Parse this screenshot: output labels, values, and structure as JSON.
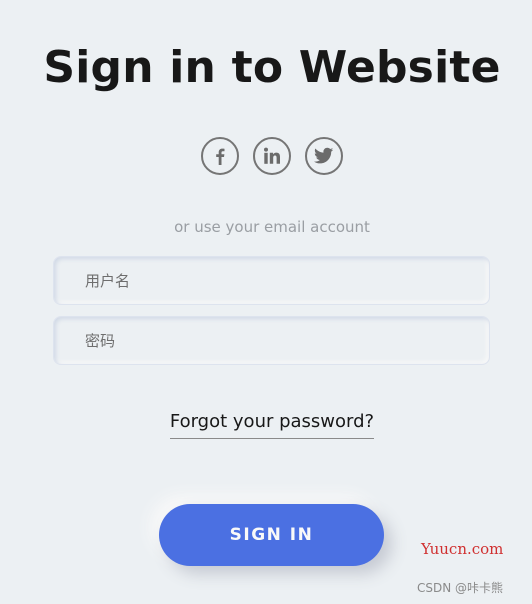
{
  "form": {
    "title": "Sign in to Website",
    "social": [
      {
        "icon": "facebook-icon"
      },
      {
        "icon": "linkedin-icon"
      },
      {
        "icon": "twitter-icon"
      }
    ],
    "subtitle": "or use your email account",
    "username": {
      "placeholder": "用户名",
      "value": ""
    },
    "password": {
      "placeholder": "密码",
      "value": ""
    },
    "forgot_label": "Forgot your password?",
    "signin_label": "SIGN IN"
  },
  "watermarks": {
    "site": "Yuucn.com",
    "author": "CSDN @咔卡熊"
  },
  "colors": {
    "background": "#ecf0f3",
    "accent": "#4b70e2",
    "watermark_site": "#d03030"
  }
}
